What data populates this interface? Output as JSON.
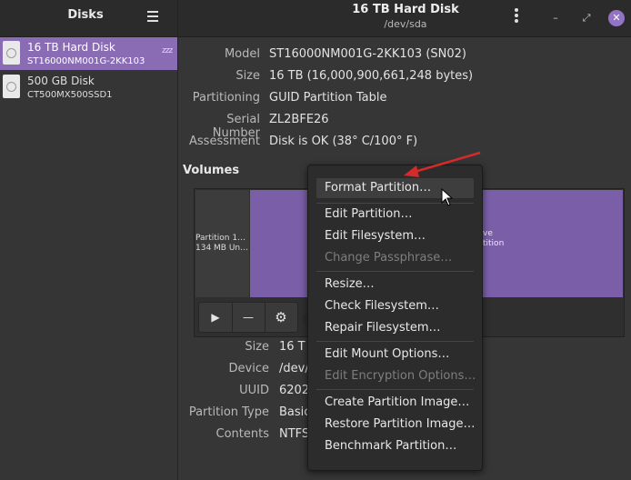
{
  "sidebar": {
    "title": "Disks",
    "menu_icon": "hamburger-menu-icon",
    "disks": [
      {
        "name": "16 TB Hard Disk",
        "model": "ST16000NM001G-2KK103",
        "selected": true,
        "status_text": "zzz"
      },
      {
        "name": "500 GB Disk",
        "model": "CT500MX500SSD1",
        "selected": false
      }
    ]
  },
  "header": {
    "title": "16 TB Hard Disk",
    "subtitle": "/dev/sda",
    "kebab_icon": "more-options-icon",
    "minimize_glyph": "–",
    "maximize_glyph": "⤢",
    "close_glyph": "✕"
  },
  "disk_properties": [
    {
      "label": "Model",
      "value": "ST16000NM001G-2KK103 (SN02)"
    },
    {
      "label": "Size",
      "value": "16 TB (16,000,900,661,248 bytes)"
    },
    {
      "label": "Partitioning",
      "value": "GUID Partition Table"
    },
    {
      "label": "Serial Number",
      "value": "ZL2BFE26"
    },
    {
      "label": "Assessment",
      "value": "Disk is OK (38° C/100° F)"
    }
  ],
  "volumes": {
    "title": "Volumes",
    "partition1_line1": "Partition 1…",
    "partition1_line2": "134 MB Un…",
    "partition2_line1": "ve",
    "partition2_line2": "tition",
    "toolbar": {
      "play_glyph": "▶",
      "minus_glyph": "—",
      "gear_glyph": "⚙"
    }
  },
  "partition_properties": [
    {
      "label": "Size",
      "value": "16 T"
    },
    {
      "label": "Device",
      "value": "/dev/"
    },
    {
      "label": "UUID",
      "value": "6202"
    },
    {
      "label": "Partition Type",
      "value": "Basic"
    },
    {
      "label": "Contents",
      "value": "NTFS"
    }
  ],
  "menu": {
    "items": [
      {
        "label": "Format Partition…",
        "enabled": true,
        "highlighted": true
      },
      {
        "label": "Edit Partition…",
        "enabled": true
      },
      {
        "label": "Edit Filesystem…",
        "enabled": true
      },
      {
        "label": "Change Passphrase…",
        "enabled": false
      },
      {
        "label": "Resize…",
        "enabled": true
      },
      {
        "label": "Check Filesystem…",
        "enabled": true
      },
      {
        "label": "Repair Filesystem…",
        "enabled": true
      },
      {
        "label": "Edit Mount Options…",
        "enabled": true
      },
      {
        "label": "Edit Encryption Options…",
        "enabled": false
      },
      {
        "label": "Create Partition Image…",
        "enabled": true
      },
      {
        "label": "Restore Partition Image…",
        "enabled": true
      },
      {
        "label": "Benchmark Partition…",
        "enabled": true
      }
    ]
  },
  "colors": {
    "accent": "#8a6cb5",
    "partition_fill": "#7a5fa8",
    "annotation_arrow": "#d42a2a"
  }
}
